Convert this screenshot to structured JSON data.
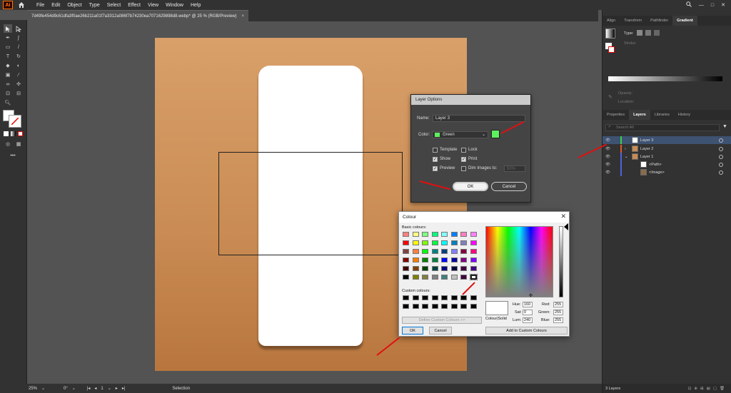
{
  "app": {
    "logo": "Ai"
  },
  "menu": [
    "File",
    "Edit",
    "Object",
    "Type",
    "Select",
    "Effect",
    "View",
    "Window",
    "Help"
  ],
  "document_tab": {
    "title": "7d49fe454d9c61dfa3f0ae26b211a01f7a3312a086f7b74230ea7071629898d8.webp* @ 25 % (RGB/Preview)",
    "close": "×"
  },
  "status": {
    "zoom": "25%",
    "rotation": "0°",
    "artboard": "1",
    "tool": "Selection"
  },
  "panel_tabs_top": [
    "Align",
    "Transform",
    "Pathfinder",
    "Gradient"
  ],
  "gradient": {
    "type_label": "Type:",
    "stroke_label": "Stroke:",
    "opacity_label": "Opacity:",
    "location_label": "Location:"
  },
  "panel_tabs_bottom": [
    "Properties",
    "Layers",
    "Libraries",
    "History"
  ],
  "layers_search_placeholder": "Search All",
  "layers": [
    {
      "name": "Layer 3",
      "color": "#3bd14a",
      "selected": true
    },
    {
      "name": "Layer 2",
      "color": "#e05a2a",
      "selected": false
    },
    {
      "name": "Layer 1",
      "color": "#4b63e0",
      "selected": false
    },
    {
      "name": "<Path>",
      "color": "#4b63e0",
      "selected": false
    },
    {
      "name": "<Image>",
      "color": "#4b63e0",
      "selected": false
    }
  ],
  "layers_count": "3 Layers",
  "layer_options": {
    "title": "Layer Options",
    "name_label": "Name:",
    "name_value": "Layer 3",
    "color_label": "Color:",
    "color_value": "Green",
    "color_swatch": "#5ef05e",
    "template": "Template",
    "lock": "Lock",
    "show": "Show",
    "print": "Print",
    "preview": "Preview",
    "dim": "Dim Images to:",
    "dim_value": "50%",
    "ok": "OK",
    "cancel": "Cancel"
  },
  "colour_dialog": {
    "title": "Colour",
    "basic_label": "Basic colours:",
    "custom_label": "Custom colours:",
    "define_btn": "Define Custom Colours >>",
    "ok": "OK",
    "cancel": "Cancel",
    "colour_solid": "Colour|Solid",
    "hue_label": "Hue:",
    "hue": "160",
    "sat_label": "Sat:",
    "sat": "0",
    "lum_label": "Lum:",
    "lum": "240",
    "red_label": "Red:",
    "red": "255",
    "green_label": "Green:",
    "green": "255",
    "blue_label": "Blue:",
    "blue": "255",
    "add_btn": "Add to Custom Colours",
    "basic_colours": [
      [
        "#ff8080",
        "#ffff80",
        "#80ff80",
        "#00ff80",
        "#80ffff",
        "#0080ff",
        "#ff80c0",
        "#ff80ff"
      ],
      [
        "#ff0000",
        "#ffff00",
        "#80ff00",
        "#00ff40",
        "#00ffff",
        "#0080c0",
        "#8080c0",
        "#ff00ff"
      ],
      [
        "#804040",
        "#ff8040",
        "#00ff00",
        "#008080",
        "#004080",
        "#8080ff",
        "#800040",
        "#ff0080"
      ],
      [
        "#800000",
        "#ff8000",
        "#008000",
        "#008040",
        "#0000ff",
        "#0000a0",
        "#800080",
        "#8000ff"
      ],
      [
        "#400000",
        "#804000",
        "#004000",
        "#004040",
        "#000080",
        "#000040",
        "#400040",
        "#400080"
      ],
      [
        "#000000",
        "#808000",
        "#808040",
        "#808080",
        "#408080",
        "#c0c0c0",
        "#400040",
        "#ffffff"
      ]
    ]
  }
}
